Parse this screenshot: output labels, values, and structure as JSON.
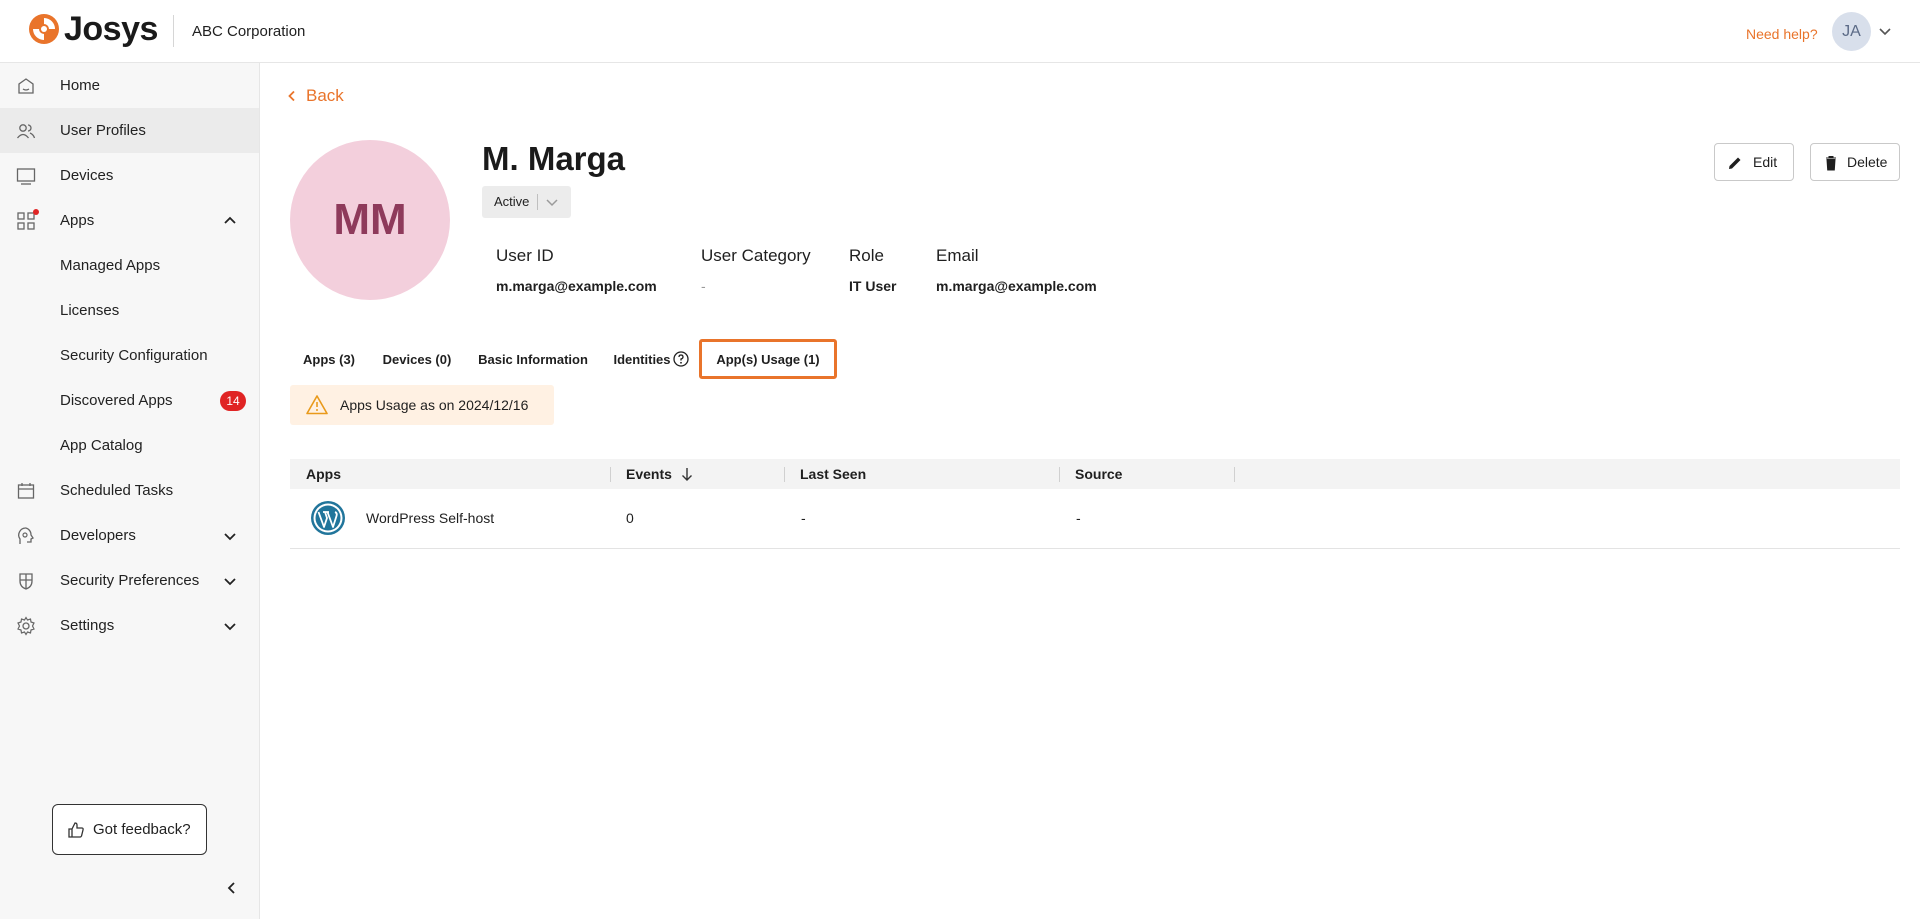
{
  "header": {
    "brand": "Josys",
    "org": "ABC Corporation",
    "need_help": "Need help?",
    "user_initials": "JA",
    "accent": "#e9742b"
  },
  "sidebar": {
    "items": [
      {
        "label": "Home",
        "icon": "home-icon"
      },
      {
        "label": "User Profiles",
        "icon": "users-icon",
        "active": true
      },
      {
        "label": "Devices",
        "icon": "monitor-icon"
      },
      {
        "label": "Apps",
        "icon": "apps-grid-icon",
        "expanded": true
      },
      {
        "label": "Managed Apps"
      },
      {
        "label": "Licenses"
      },
      {
        "label": "Security Configuration"
      },
      {
        "label": "Discovered Apps",
        "badge": "14"
      },
      {
        "label": "App Catalog"
      },
      {
        "label": "Scheduled Tasks",
        "icon": "calendar-icon"
      },
      {
        "label": "Developers",
        "icon": "developer-icon"
      },
      {
        "label": "Security Preferences",
        "icon": "shield-icon"
      },
      {
        "label": "Settings",
        "icon": "gear-icon"
      }
    ],
    "feedback": "Got feedback?"
  },
  "page": {
    "back": "Back",
    "initials": "MM",
    "name": "M. Marga",
    "status": "Active",
    "edit": "Edit",
    "delete": "Delete",
    "fields": {
      "user_id_label": "User ID",
      "user_id_value": "m.marga@example.com",
      "category_label": "User Category",
      "category_value": "-",
      "role_label": "Role",
      "role_value": "IT User",
      "email_label": "Email",
      "email_value": "m.marga@example.com"
    },
    "tabs": [
      {
        "label": "Apps (3)"
      },
      {
        "label": "Devices (0)"
      },
      {
        "label": "Basic Information"
      },
      {
        "label": "Identities"
      },
      {
        "label": "App(s) Usage (1)",
        "selected": true
      }
    ],
    "notice": "Apps Usage as on 2024/12/16"
  },
  "table": {
    "columns": [
      "Apps",
      "Events",
      "Last Seen",
      "Source"
    ],
    "rows": [
      {
        "app": "WordPress Self-host",
        "events": "0",
        "last_seen": "-",
        "source": "-"
      }
    ]
  }
}
